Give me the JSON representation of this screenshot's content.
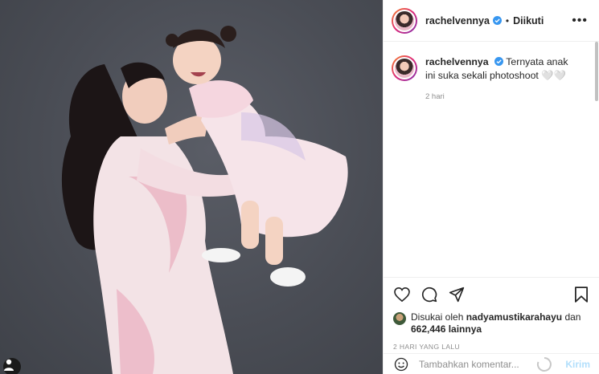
{
  "post": {
    "username": "rachelvennya",
    "follow_status": "Diikuti",
    "separator": "•",
    "more_glyph": "•••",
    "caption": "Ternyata anak ini suka sekali photoshoot 🤍🤍",
    "caption_time": "2 hari",
    "liked_prefix": "Disukai oleh",
    "liked_by": "nadyamustikarahayu",
    "liked_joiner": "dan",
    "liked_count": "662,446 lainnya",
    "time_ago": "2 HARI YANG LALU"
  },
  "comment": {
    "placeholder": "Tambahkan komentar...",
    "send_label": "Kirim"
  },
  "colors": {
    "verified": "#3897f0",
    "send_disabled": "#b2dffc",
    "secondary_text": "#8e8e8e",
    "border": "#efefef",
    "photo_background": "#4a4d55"
  },
  "icons": [
    "verified-badge-icon",
    "more-options-icon",
    "heart-icon",
    "comment-icon",
    "share-icon",
    "bookmark-icon",
    "emoji-icon",
    "loading-spinner-icon",
    "profile-icon"
  ]
}
